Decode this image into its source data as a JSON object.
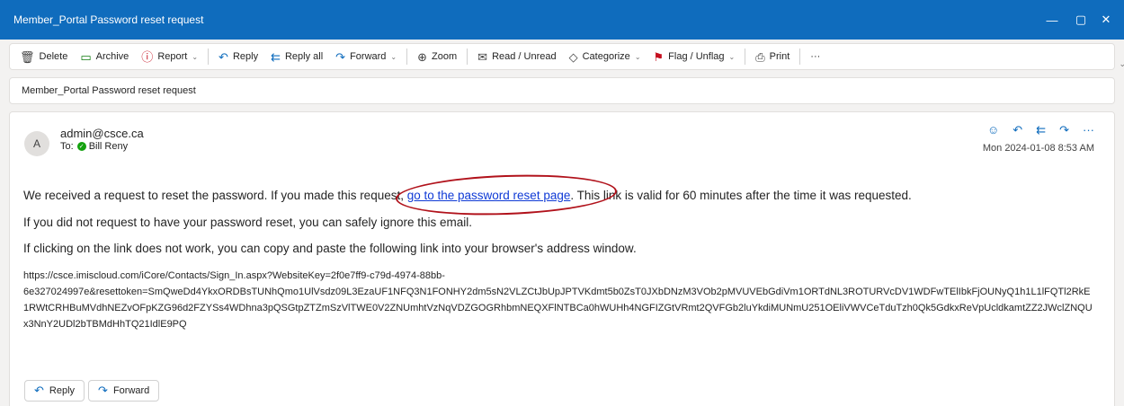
{
  "window": {
    "title": "Member_Portal Password reset request",
    "controls": {
      "minimize": "—",
      "restore": "▢",
      "close": "✕"
    }
  },
  "toolbar": {
    "items": [
      {
        "id": "delete",
        "label": "Delete",
        "icon": "🗑"
      },
      {
        "id": "archive",
        "label": "Archive",
        "icon": "▭"
      },
      {
        "id": "report",
        "label": "Report",
        "icon": "ⓘ"
      },
      {
        "id": "reply",
        "label": "Reply",
        "icon": "↶"
      },
      {
        "id": "reply-all",
        "label": "Reply all",
        "icon": "⇇"
      },
      {
        "id": "forward",
        "label": "Forward",
        "icon": "↷"
      },
      {
        "id": "zoom",
        "label": "Zoom",
        "icon": "⊕"
      },
      {
        "id": "read-unread",
        "label": "Read / Unread",
        "icon": "✉"
      },
      {
        "id": "categorize",
        "label": "Categorize",
        "icon": "◇"
      },
      {
        "id": "flag",
        "label": "Flag / Unflag",
        "icon": "⚑"
      },
      {
        "id": "print",
        "label": "Print",
        "icon": "⎙"
      }
    ],
    "more": "···",
    "chevron": "⌄"
  },
  "subject": "Member_Portal Password reset request",
  "message": {
    "avatar_initial": "A",
    "sender": "admin@csce.ca",
    "to_label": "To:",
    "recipient": "Bill Reny",
    "date": "Mon 2024-01-08 8:53 AM",
    "actions": [
      "☺",
      "↶",
      "⇇",
      "↷",
      "···"
    ],
    "para1_before": "We received a request to reset the password. If you made this request, ",
    "link_text": "go to the password reset page",
    "para1_after": ". This link is valid for 60 minutes after the time it was requested.",
    "para2": "If you did not request to have your password reset, you can safely ignore this email.",
    "para3": "If clicking on the link does not work, you can copy and paste the following link into your browser's address window.",
    "url_lines": [
      "https://csce.imiscloud.com/iCore/Contacts/Sign_In.aspx?WebsiteKey=2f0e7ff9-c79d-4974-88bb-",
      "6e327024997e&resettoken=SmQweDd4YkxORDBsTUNhQmo1UlVsdz09L3EzaUF1NFQ3N1FONHY2dm5sN2VLZCtJbUpJPTVKdmt5b0ZsT0JXbDNzM3VOb2pMVUVEbGdiVm1ORTdNL3ROTURVcDV1WDFwTElIbkFjOUNyQ1h1L1lFQTl2RkE",
      "1RWtCRHBuMVdhNEZvOFpKZG96d2FZYSs4WDhna3pQSGtpZTZmSzVlTWE0V2ZNUmhtVzNqVDZGOGRhbmNEQXFlNTBCa0hWUHh4NGFIZGtVRmt2QVFGb2luYkdiMUNmU251OEliVWVCeTduTzh0Qk5GdkxReVpUcldkamtZZ2JWclZNQU",
      "x3NnY2UDl2bTBMdHhTQ21IdlE9PQ"
    ]
  },
  "footer": {
    "reply": {
      "label": "Reply",
      "icon": "↶"
    },
    "forward": {
      "label": "Forward",
      "icon": "↷"
    }
  }
}
